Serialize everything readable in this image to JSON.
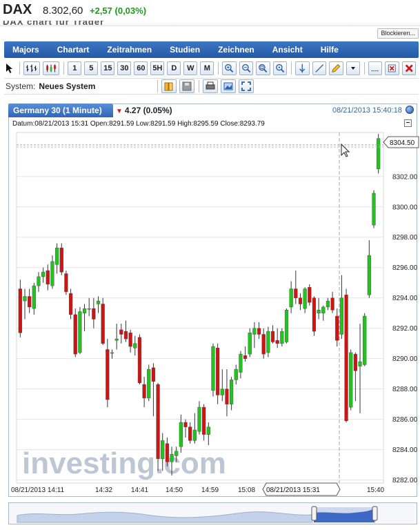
{
  "header": {
    "ticker": "DAX",
    "price": "8.302,60",
    "change": "+2,57 (0,03%)",
    "cut_text": "DAX chart fur Trader"
  },
  "block_button": "Blockieren...",
  "menu": [
    "Majors",
    "Chartart",
    "Zeitrahmen",
    "Studien",
    "Zeichnen",
    "Ansicht",
    "Hilfe"
  ],
  "toolbar": {
    "intervals": [
      "1",
      "5",
      "15",
      "30",
      "60",
      "5H",
      "D",
      "W",
      "M"
    ]
  },
  "system": {
    "label": "System:",
    "value": "Neues System"
  },
  "tab": {
    "title": "Germany 30 (1 Minute)",
    "change": "4.27 (0.05%)",
    "time": "08/21/2013 15:40:18"
  },
  "info_line": "Datum:08/21/2013 15:31 Open:8291.59 Low:8291.59 High:8295.59 Close:8293.79",
  "watermark": "investing.com",
  "cursor_time_label": "08/21/2013 15:31",
  "price_marker": "8304.50",
  "colors": {
    "up": "#22c31f",
    "down": "#d01414",
    "grid": "#e3e3e3",
    "accent": "#2559a6"
  },
  "chart_data": {
    "type": "candlestick",
    "y_ticks": [
      "8282.00",
      "8284.00",
      "8286.00",
      "8288.00",
      "8290.00",
      "8292.00",
      "8294.00",
      "8296.00",
      "8298.00",
      "8300.00",
      "8302.00"
    ],
    "ylim": [
      8281.8,
      8304.9
    ],
    "x_ticks": [
      "08/21/2013 14:11",
      "14:32",
      "14:41",
      "14:50",
      "14:59",
      "15:08",
      "15:40"
    ],
    "last_price": 8304.5,
    "candles": [
      [
        8294.6,
        8295.2,
        8291.4,
        8291.7
      ],
      [
        8293.8,
        8294.6,
        8292.6,
        8294.1
      ],
      [
        8294.1,
        8294.6,
        8293.0,
        8293.4
      ],
      [
        8293.3,
        8295.0,
        8292.9,
        8294.8
      ],
      [
        8294.8,
        8295.7,
        8294.4,
        8295.4
      ],
      [
        8295.4,
        8296.0,
        8295.0,
        8295.7
      ],
      [
        8295.8,
        8296.2,
        8294.5,
        8294.9
      ],
      [
        8294.8,
        8296.8,
        8294.6,
        8296.4
      ],
      [
        8296.2,
        8297.6,
        8295.6,
        8297.3
      ],
      [
        8297.3,
        8297.6,
        8295.5,
        8295.7
      ],
      [
        8295.6,
        8295.8,
        8294.2,
        8294.4
      ],
      [
        8294.3,
        8294.6,
        8292.6,
        8292.9
      ],
      [
        8292.9,
        8293.3,
        8290.1,
        8290.3
      ],
      [
        8290.4,
        8293.4,
        8290.3,
        8293.1
      ],
      [
        8293.0,
        8293.6,
        8291.8,
        8293.3
      ],
      [
        8293.3,
        8294.0,
        8292.8,
        8293.3
      ],
      [
        8293.3,
        8294.0,
        8292.0,
        8292.6
      ],
      [
        8293.6,
        8294.1,
        8293.0,
        8293.8
      ],
      [
        8293.6,
        8294.0,
        8290.9,
        8291.0
      ],
      [
        8290.6,
        8291.3,
        8286.8,
        8287.3
      ],
      [
        8290.4,
        8290.6,
        8290.0,
        8290.4
      ],
      [
        8291.2,
        8292.3,
        8290.6,
        8291.3
      ],
      [
        8291.9,
        8292.3,
        8291.0,
        8291.6
      ],
      [
        8291.8,
        8292.5,
        8291.1,
        8291.3
      ],
      [
        8291.7,
        8291.9,
        8290.4,
        8290.8
      ],
      [
        8290.7,
        8291.5,
        8290.2,
        8291.0
      ],
      [
        8291.4,
        8291.6,
        8288.3,
        8288.4
      ],
      [
        8288.3,
        8288.8,
        8286.8,
        8287.4
      ],
      [
        8287.4,
        8289.6,
        8287.2,
        8289.3
      ],
      [
        8289.4,
        8289.7,
        8286.2,
        8288.5
      ],
      [
        8288.3,
        8288.4,
        8282.6,
        8283.4
      ],
      [
        8283.4,
        8285.1,
        8282.6,
        8284.6
      ],
      [
        8284.4,
        8284.8,
        8282.9,
        8283.2
      ],
      [
        8283.2,
        8284.2,
        8282.3,
        8283.7
      ],
      [
        8283.6,
        8284.2,
        8283.2,
        8283.9
      ],
      [
        8284.2,
        8286.3,
        8283.8,
        8285.8
      ],
      [
        8285.8,
        8286.0,
        8284.8,
        8285.5
      ],
      [
        8285.5,
        8285.8,
        8284.4,
        8284.6
      ],
      [
        8284.6,
        8286.4,
        8284.4,
        8285.3
      ],
      [
        8285.2,
        8287.2,
        8285.0,
        8286.8
      ],
      [
        8286.8,
        8287.0,
        8284.6,
        8285.0
      ],
      [
        8285.0,
        8285.8,
        8284.3,
        8285.5
      ],
      [
        8287.9,
        8291.0,
        8287.5,
        8290.8
      ],
      [
        8290.7,
        8291.0,
        8287.0,
        8287.6
      ],
      [
        8287.6,
        8289.3,
        8287.2,
        8288.0
      ],
      [
        8288.0,
        8289.3,
        8286.2,
        8287.0
      ],
      [
        8287.0,
        8288.8,
        8286.6,
        8288.6
      ],
      [
        8288.6,
        8289.6,
        8288.3,
        8289.3
      ],
      [
        8289.1,
        8290.5,
        8288.7,
        8290.3
      ],
      [
        8290.2,
        8290.8,
        8289.8,
        8290.0
      ],
      [
        8290.3,
        8292.0,
        8290.1,
        8291.7
      ],
      [
        8291.6,
        8292.4,
        8290.7,
        8292.0
      ],
      [
        8292.0,
        8292.4,
        8291.3,
        8291.6
      ],
      [
        8291.6,
        8292.0,
        8290.0,
        8290.3
      ],
      [
        8290.4,
        8292.1,
        8290.1,
        8291.8
      ],
      [
        8291.8,
        8292.2,
        8291.0,
        8291.1
      ],
      [
        8291.2,
        8292.0,
        8290.7,
        8291.0
      ],
      [
        8291.0,
        8292.0,
        8290.8,
        8291.8
      ],
      [
        8291.1,
        8293.3,
        8291.0,
        8293.2
      ],
      [
        8293.4,
        8295.1,
        8293.0,
        8294.6
      ],
      [
        8294.6,
        8295.8,
        8293.6,
        8294.0
      ],
      [
        8294.0,
        8294.3,
        8293.2,
        8293.6
      ],
      [
        8293.3,
        8294.7,
        8293.0,
        8294.6
      ],
      [
        8294.7,
        8294.9,
        8293.5,
        8293.7
      ],
      [
        8294.0,
        8294.1,
        8291.5,
        8291.8
      ],
      [
        8293.0,
        8294.0,
        8292.6,
        8293.2
      ],
      [
        8293.0,
        8293.5,
        8292.5,
        8293.4
      ],
      [
        8293.4,
        8294.0,
        8293.2,
        8293.8
      ],
      [
        8294.0,
        8294.4,
        8293.0,
        8293.2
      ],
      [
        8292.8,
        8293.3,
        8290.8,
        8291.2
      ],
      [
        8291.6,
        8295.5,
        8291.3,
        8294.0
      ],
      [
        8294.2,
        8294.6,
        8285.8,
        8285.9
      ],
      [
        8286.8,
        8290.6,
        8286.6,
        8290.4
      ],
      [
        8290.3,
        8290.4,
        8287.2,
        8289.2
      ],
      [
        8289.5,
        8292.3,
        8286.4,
        8289.8
      ],
      [
        8289.6,
        8293.0,
        8289.5,
        8292.8
      ],
      [
        8294.2,
        8297.8,
        8294.0,
        8296.8
      ],
      [
        8298.8,
        8301.1,
        8298.6,
        8300.9
      ],
      [
        8302.5,
        8304.8,
        8302.2,
        8304.5
      ]
    ]
  }
}
